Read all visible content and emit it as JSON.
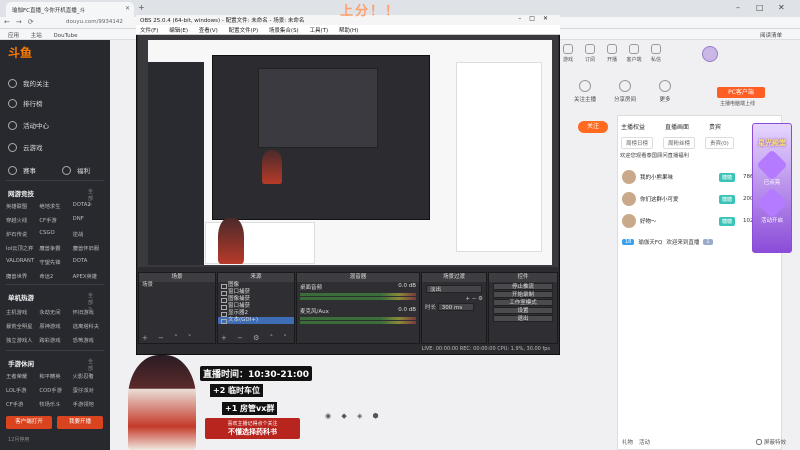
{
  "browser": {
    "tab_title": "瑜伽FC直播_今你开机直播_斗",
    "address": "douyu.com/9934142",
    "bookmarks": [
      "应用",
      "主站",
      "DouTube"
    ],
    "bookmarks_right": "阅读清单"
  },
  "banner": "上分！！",
  "sidebar": {
    "logo": "斗鱼",
    "items": [
      "我的关注",
      "排行榜",
      "活动中心",
      "云游戏",
      "赛事",
      "福利"
    ],
    "sections": [
      {
        "title": "网游竞技",
        "more": "全部 >",
        "games": [
          "英雄联盟",
          "绝地求生",
          "DOTA2",
          "穿越火线",
          "CF手游",
          "DNF",
          "炉石传说",
          "CSGO",
          "逆战",
          "lol云顶之弈",
          "魔兽争霸",
          "魔兽怀旧服",
          "VALORANT",
          "守望先锋",
          "DOTA",
          "魔兽世界",
          "命运2",
          "APEX英雄"
        ]
      },
      {
        "title": "单机热游",
        "more": "全部 >",
        "games": [
          "主机游戏",
          "永劫无间",
          "怀旧游戏",
          "暴荒全明星",
          "原神游戏",
          "逃离塔科夫",
          "独立游戏人",
          "跨彩游戏",
          "恐怖游戏"
        ]
      },
      {
        "title": "手游休闲",
        "more": "全部 >",
        "games": [
          "王者荣耀",
          "和平精英",
          "火影忍者",
          "LOL手游",
          "COD手游",
          "蛋仔派对",
          "CF手游",
          "牧场乐斗",
          "手游领地"
        ]
      }
    ],
    "btn_left": "客户端打开",
    "btn_right": "我要开播",
    "footer": "12月停用"
  },
  "topnav": [
    "游戏",
    "订阅",
    "开播",
    "客户端",
    "私信"
  ],
  "actions": [
    "关注主播",
    "分享房间",
    "更多"
  ],
  "pc_btn": "PC客户端",
  "pc_sub": "主播电脑端上线",
  "follow_btn": "关注",
  "right_panel": {
    "tabs": [
      "主播权益",
      "直播画面",
      "贵宾"
    ],
    "subtabs": [
      "周榜日榜",
      "周粉丝榜",
      "贵宾(0)"
    ],
    "notice": "欢迎您观看泰国顾问直播福利",
    "ranks": [
      {
        "name": "我的小熊果味",
        "level": "糖糖",
        "num": "7864"
      },
      {
        "name": "你们这群小可爱",
        "level": "糖糖",
        "num": "2002"
      },
      {
        "name": "好物～",
        "level": "糖糖",
        "num": "1028"
      }
    ],
    "chat": {
      "badge": "18",
      "user": "瑜伽天FQ",
      "text": "欢迎来到直播",
      "badge2": "1"
    },
    "bottom": [
      "礼物",
      "活动"
    ],
    "check_label": "屏蔽特效"
  },
  "purple_promo": {
    "title": "星光殿堂",
    "sub1": "已点亮",
    "sub2": "活动开启"
  },
  "obs": {
    "title": "OBS 25.0.4 (64-bit, windows) - 配置文件: 未命名 - 场景: 未命名",
    "menu": [
      "文件(F)",
      "编辑(E)",
      "查看(V)",
      "配置文件(P)",
      "场景集合(S)",
      "工具(T)",
      "帮助(H)"
    ],
    "docks": {
      "scenes": {
        "title": "场景",
        "items": [
          "场景"
        ]
      },
      "sources": {
        "title": "来源",
        "items": [
          "图像",
          "窗口捕获",
          "图像捕获",
          "窗口捕获",
          "显示器2",
          "文本(GDI+)"
        ]
      },
      "mixer": {
        "title": "混音器",
        "items": [
          {
            "name": "桌面音频",
            "db": "0.0 dB"
          },
          {
            "name": "麦克风/Aux",
            "db": "0.0 dB"
          }
        ]
      },
      "transitions": {
        "title": "场景过渡",
        "mode": "淡出",
        "duration_label": "时长",
        "duration": "300 ms"
      },
      "controls": {
        "title": "控件",
        "buttons": [
          "停止推流",
          "开始录制",
          "工作室模式",
          "设置",
          "退出"
        ]
      }
    },
    "status": "LIVE: 00:00:00   REC: 00:00:00   CPU: 1.9%, 30.00 fps"
  },
  "overlay": {
    "time_label": "直播时间：10:30-21:00",
    "line1": "+2  临时车位",
    "line2": "+1  房管vx群",
    "tag_top": "喜欢主播记得点个关注",
    "tag_main": "不懂选择药科书"
  }
}
